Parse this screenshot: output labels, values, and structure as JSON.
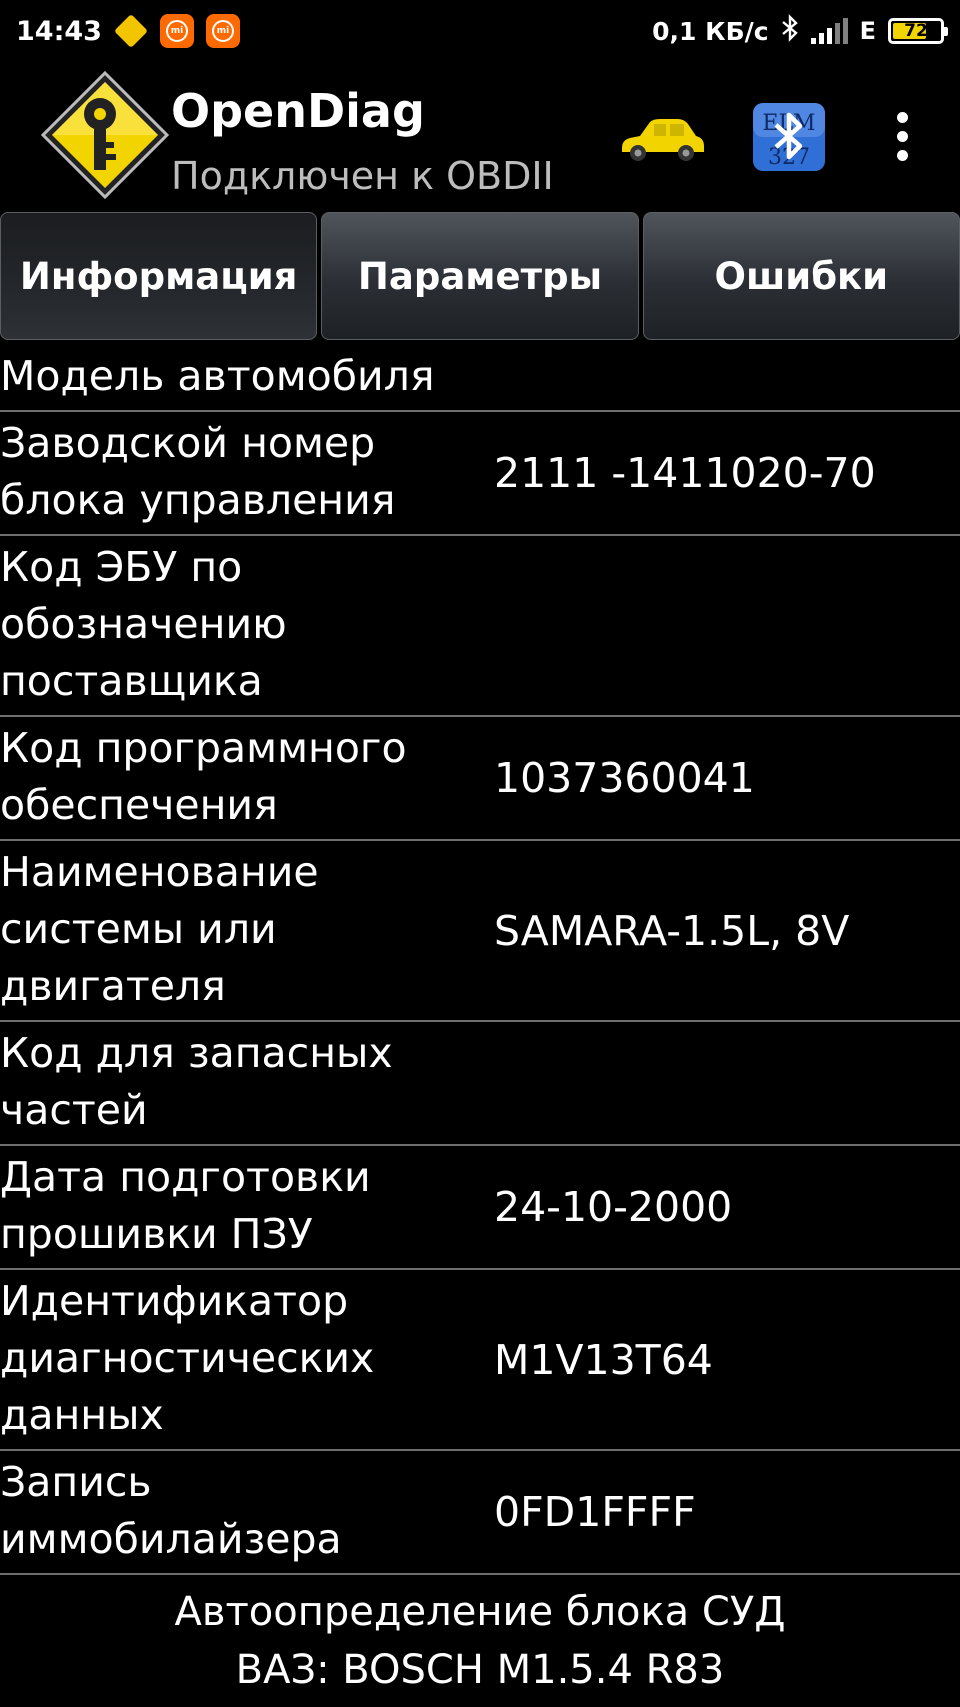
{
  "status_bar": {
    "time": "14:43",
    "speed": "0,1 КБ/с",
    "network": "E",
    "battery": "72",
    "battery_percent": 72
  },
  "app": {
    "title": "OpenDiag",
    "subtitle": "Подключен к OBDII"
  },
  "tabs": [
    {
      "label": "Информация",
      "active": true
    },
    {
      "label": "Параметры",
      "active": false
    },
    {
      "label": "Ошибки",
      "active": false
    }
  ],
  "info_rows": [
    {
      "label": "Модель автомобиля",
      "value": ""
    },
    {
      "label": "Заводской номер\nблока управления",
      "value": "2111 -1411020-70"
    },
    {
      "label": "Код ЭБУ по\nобозначению\nпоставщика",
      "value": ""
    },
    {
      "label": "Код программного\nобеспечения",
      "value": "1037360041"
    },
    {
      "label": "Наименование\nсистемы или\nдвигателя",
      "value": "SAMARA-1.5L, 8V"
    },
    {
      "label": "Код для запасных\nчастей",
      "value": ""
    },
    {
      "label": "Дата подготовки\nпрошивки ПЗУ",
      "value": "24-10-2000"
    },
    {
      "label": "Идентификатор\nдиагностических\nданных",
      "value": "M1V13T64"
    },
    {
      "label": "Запись\nиммобилайзера",
      "value": "0FD1FFFF"
    }
  ],
  "footer": {
    "line1": "Автоопределение блока СУД",
    "line2": "ВАЗ: BOSCH M1.5.4 R83"
  },
  "colors": {
    "background": "#000000",
    "subtitle": "#bdbdbd",
    "divider": "#6e6e6e",
    "logo_yellow": "#f2d500",
    "bluetooth_blue": "#2f6fd6"
  },
  "icons": {
    "logo": "key-diamond-icon",
    "car": "car-icon",
    "adapter": "elm327-bluetooth-icon",
    "menu": "more-vert-icon"
  }
}
